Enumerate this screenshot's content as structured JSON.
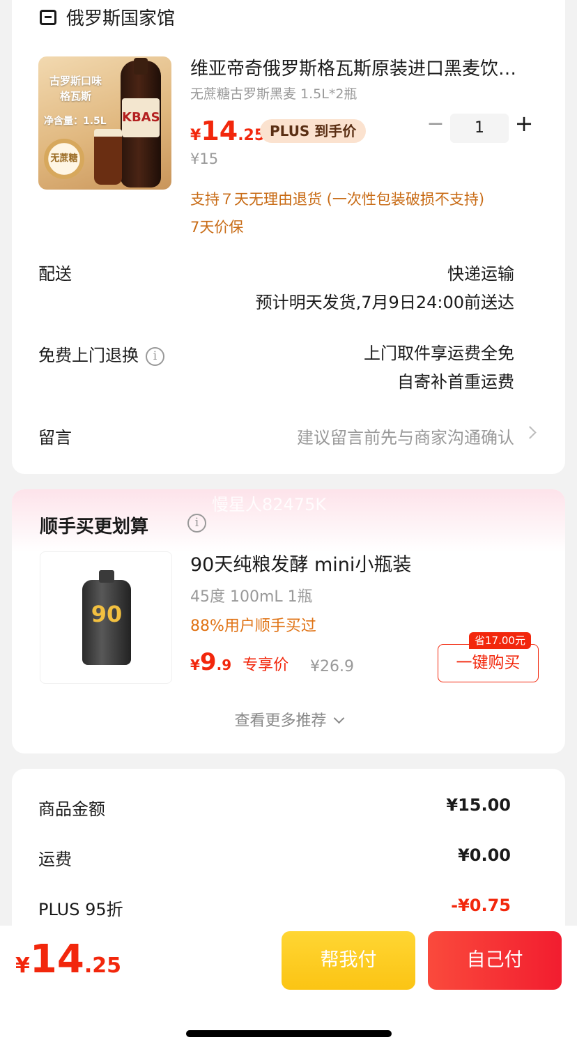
{
  "shop": {
    "name": "俄罗斯国家馆",
    "icon": "store-icon"
  },
  "product": {
    "title": "维亚帝奇俄罗斯格瓦斯原装进口黑麦饮…",
    "spec": "无蔗糖古罗斯黑麦 1.5L*2瓶",
    "image": {
      "line1": "古罗斯口味",
      "line2": "格瓦斯",
      "net": "净含量：1.5L",
      "seal": "无蔗糖",
      "brand": "KBAS"
    },
    "price_yen": "¥",
    "price_int": "14",
    "price_dec": ".25",
    "plus_tag": "PLUS 到手价",
    "orig_price": "¥15",
    "qty_minus": "−",
    "quantity": "1",
    "qty_plus": "+",
    "policy_return": "支持７天无理由退货 (一次性包装破损不支持)",
    "policy_price": "7天价保"
  },
  "delivery": {
    "label": "配送",
    "method": "快递运输",
    "eta": "预计明天发货,7月9日24:00前送达"
  },
  "pickup": {
    "label": "免费上门退换",
    "info_icon": "i",
    "line1": "上门取件享运费全免",
    "line2": "自寄补首重运费"
  },
  "message": {
    "label": "留言",
    "placeholder": "建议留言前先与商家沟通确认"
  },
  "recommend": {
    "title": "顺手买更划算",
    "info_icon": "i",
    "watermark": "慢星人82475K",
    "item": {
      "name": "90天纯粮发酵 mini小瓶装",
      "spec": "45度 100mL 1瓶",
      "bought": "88%用户顺手买过",
      "price_yen": "¥",
      "price_int": "9",
      "price_dec": ".9",
      "price_tag": "专享价",
      "orig_price": "¥26.9",
      "save_tag": "省17.00元",
      "buy_label": "一键购买",
      "bottle_text": "90"
    },
    "more_label": "查看更多推荐"
  },
  "totals": {
    "goods_label": "商品金额",
    "goods_value": "¥15.00",
    "shipping_label": "运费",
    "shipping_value": "¥0.00",
    "plus_label": "PLUS 95折",
    "plus_value": "-¥0.75"
  },
  "bottom": {
    "price_yen": "¥",
    "price_int": "14",
    "price_dec": ".25",
    "help_pay": "帮我付",
    "self_pay": "自己付"
  },
  "colors": {
    "accent": "#f2270c",
    "orange": "#c86b15",
    "yellow": "#fbc414"
  }
}
